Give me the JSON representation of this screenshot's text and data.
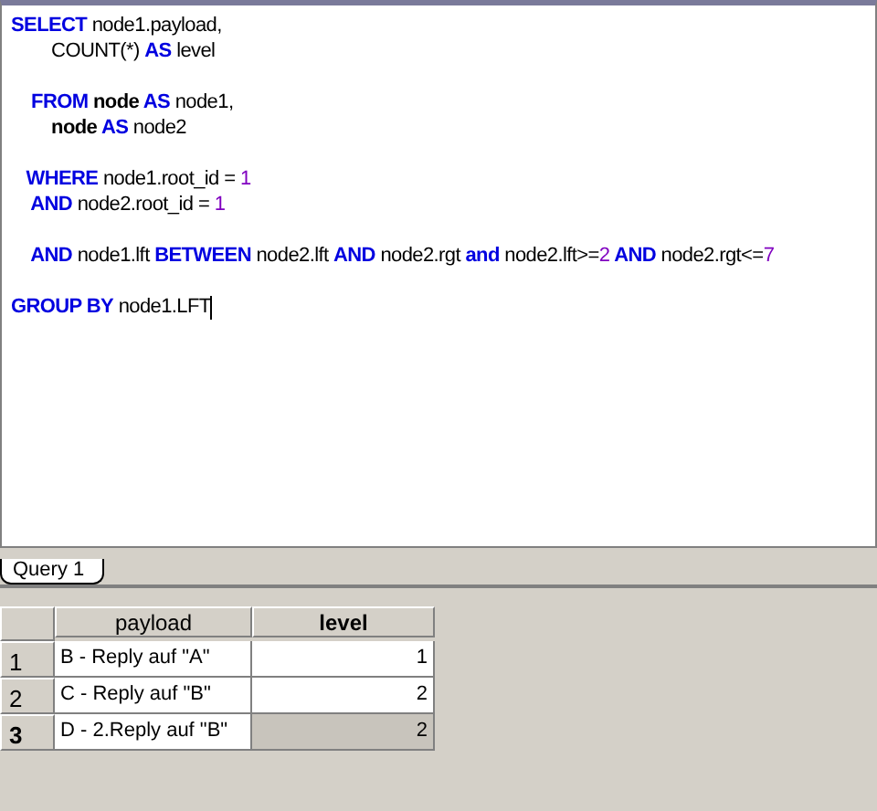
{
  "editor": {
    "blocks": [
      [
        [
          {
            "kind": "keyword",
            "text": "SELECT"
          },
          {
            "kind": "plain",
            "text": " node1.payload,"
          }
        ],
        [
          {
            "kind": "plain",
            "text": "        COUNT(*) "
          },
          {
            "kind": "keyword",
            "text": "AS"
          },
          {
            "kind": "plain",
            "text": " level"
          }
        ]
      ],
      [
        [
          {
            "kind": "keyword",
            "text": "    FROM"
          },
          {
            "kind": "bold",
            "text": " node"
          },
          {
            "kind": "keyword",
            "text": " AS"
          },
          {
            "kind": "plain",
            "text": " node1,"
          }
        ],
        [
          {
            "kind": "bold",
            "text": "        node"
          },
          {
            "kind": "keyword",
            "text": " AS"
          },
          {
            "kind": "plain",
            "text": " node2"
          }
        ]
      ],
      [
        [
          {
            "kind": "keyword",
            "text": "   WHERE"
          },
          {
            "kind": "plain",
            "text": " node1.root_id = "
          },
          {
            "kind": "number",
            "text": "1"
          }
        ],
        [
          {
            "kind": "keyword",
            "text": "    AND"
          },
          {
            "kind": "plain",
            "text": " node2.root_id = "
          },
          {
            "kind": "number",
            "text": "1"
          }
        ]
      ],
      [
        [
          {
            "kind": "keyword",
            "text": "    AND"
          },
          {
            "kind": "plain",
            "text": " node1.lft "
          },
          {
            "kind": "keyword",
            "text": "BETWEEN"
          },
          {
            "kind": "plain",
            "text": " node2.lft "
          },
          {
            "kind": "keyword",
            "text": "AND"
          },
          {
            "kind": "plain",
            "text": " node2.rgt "
          },
          {
            "kind": "keyword",
            "text": "and"
          },
          {
            "kind": "plain",
            "text": " node2.lft>="
          },
          {
            "kind": "number",
            "text": "2"
          },
          {
            "kind": "keyword",
            "text": " AND"
          },
          {
            "kind": "plain",
            "text": " node2.rgt<="
          },
          {
            "kind": "number",
            "text": "7"
          }
        ]
      ],
      [
        [
          {
            "kind": "keyword",
            "text": "GROUP BY"
          },
          {
            "kind": "plain",
            "text": " node1.LFT"
          }
        ]
      ]
    ]
  },
  "tabs": [
    {
      "label": "Query 1",
      "selected": true
    }
  ],
  "grid": {
    "columns": [
      {
        "label": "payload",
        "selected": false
      },
      {
        "label": "level",
        "selected": true
      }
    ],
    "rows": [
      {
        "number": "1",
        "selected": false,
        "cells": [
          "B - Reply auf \"A\"",
          "1"
        ]
      },
      {
        "number": "2",
        "selected": false,
        "cells": [
          "C - Reply auf \"B\"",
          "2"
        ]
      },
      {
        "number": "3",
        "selected": true,
        "cells": [
          "D - 2.Reply auf \"B\"",
          "2"
        ]
      }
    ]
  }
}
